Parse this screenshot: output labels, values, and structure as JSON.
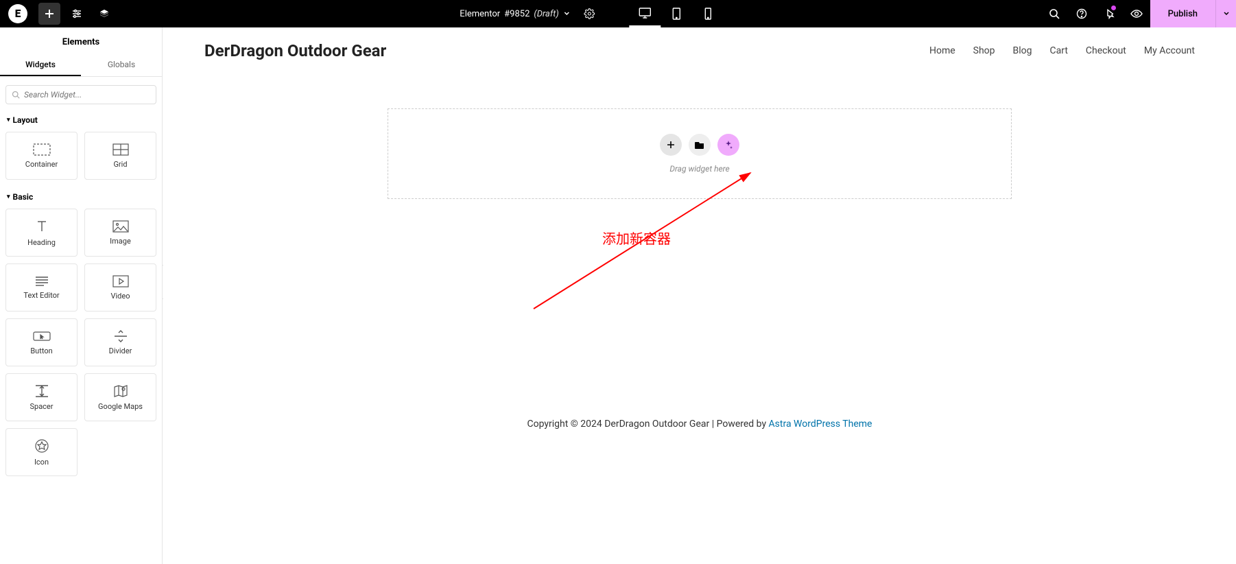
{
  "topbar": {
    "doc_title_prefix": "Elementor ",
    "doc_title_num": "#9852",
    "doc_status": "(Draft)",
    "publish_label": "Publish"
  },
  "sidebar": {
    "title": "Elements",
    "tabs": {
      "widgets": "Widgets",
      "globals": "Globals"
    },
    "search_placeholder": "Search Widget...",
    "sections": {
      "layout": {
        "label": "Layout",
        "items": [
          {
            "label": "Container"
          },
          {
            "label": "Grid"
          }
        ]
      },
      "basic": {
        "label": "Basic",
        "items": [
          {
            "label": "Heading"
          },
          {
            "label": "Image"
          },
          {
            "label": "Text Editor"
          },
          {
            "label": "Video"
          },
          {
            "label": "Button"
          },
          {
            "label": "Divider"
          },
          {
            "label": "Spacer"
          },
          {
            "label": "Google Maps"
          },
          {
            "label": "Icon"
          }
        ]
      }
    }
  },
  "site": {
    "title": "DerDragon Outdoor Gear",
    "nav": [
      "Home",
      "Shop",
      "Blog",
      "Cart",
      "Checkout",
      "My Account"
    ]
  },
  "dropzone": {
    "hint": "Drag widget here"
  },
  "annotation": {
    "text": "添加新容器"
  },
  "footer": {
    "prefix": "Copyright © 2024 DerDragon Outdoor Gear | Powered by ",
    "link": "Astra WordPress Theme"
  }
}
